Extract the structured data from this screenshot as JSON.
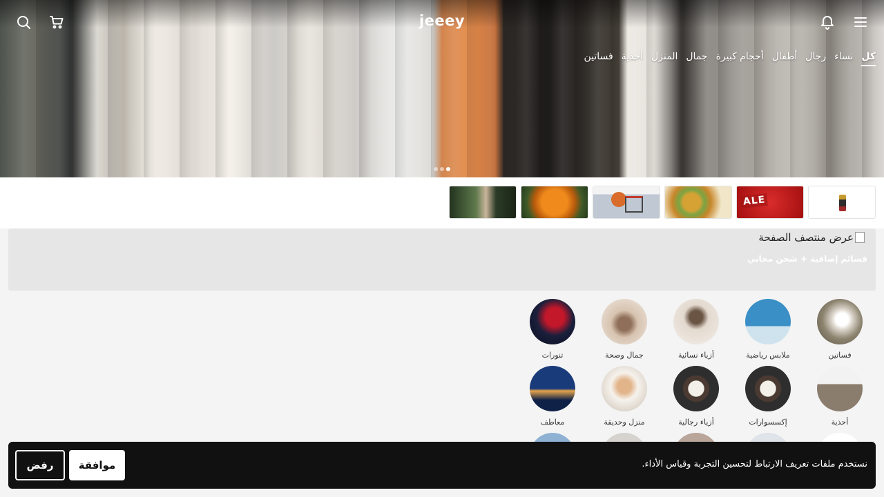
{
  "header": {
    "logo": "jeeey",
    "icons": [
      "menu-icon",
      "bell-icon",
      "search-icon",
      "cart-icon"
    ]
  },
  "category_tabs": [
    {
      "label": "كل",
      "active": true
    },
    {
      "label": "نساء",
      "active": false
    },
    {
      "label": "رجال",
      "active": false
    },
    {
      "label": "أطفال",
      "active": false
    },
    {
      "label": "أحجام كبيرة",
      "active": false
    },
    {
      "label": "جمال",
      "active": false
    },
    {
      "label": "المنزل",
      "active": false
    },
    {
      "label": "أحذية",
      "active": false
    },
    {
      "label": "فساتين",
      "active": false
    }
  ],
  "carousel": {
    "total": 3,
    "active": 3
  },
  "banner": {
    "alt_text": "عرض منتصف الصفحة",
    "subtitle": "قسائم إضافية + شحن مجاني"
  },
  "categories": [
    {
      "label": "فساتين"
    },
    {
      "label": "ملابس رياضية"
    },
    {
      "label": "أزياء نسائية"
    },
    {
      "label": "جمال وصحة"
    },
    {
      "label": "تنورات"
    },
    {
      "label": "أحذية"
    },
    {
      "label": "إكسسوارات"
    },
    {
      "label": "أزياء رجالية"
    },
    {
      "label": "منزل وحديقة"
    },
    {
      "label": "معاطف"
    },
    {
      "label": ""
    },
    {
      "label": ""
    },
    {
      "label": ""
    },
    {
      "label": ""
    },
    {
      "label": ""
    }
  ],
  "cookie": {
    "message": "نستخدم ملفات تعريف الارتباط لتحسين التجربة وقياس الأداء.",
    "accept_label": "موافقة",
    "reject_label": "رفض"
  }
}
